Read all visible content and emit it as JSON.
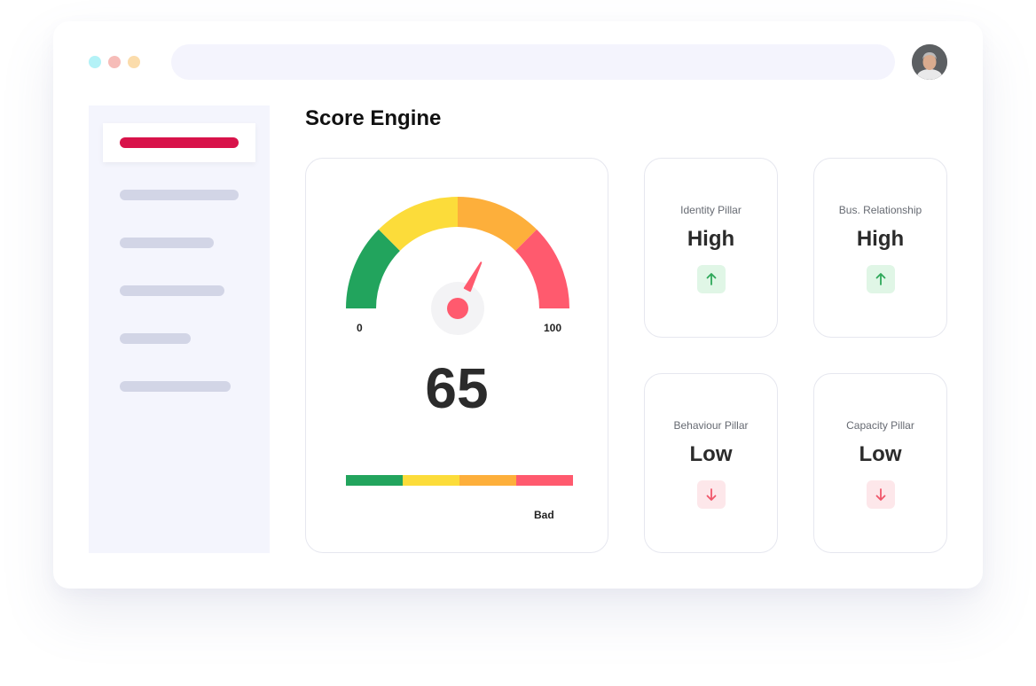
{
  "page": {
    "title": "Score Engine"
  },
  "window": {
    "dot_colors": [
      "#b3f2f7",
      "#f6bcb8",
      "#fbdcab"
    ]
  },
  "sidebar": {
    "active_color": "#d8134a",
    "item_count": 6
  },
  "gauge": {
    "min_label": "0",
    "max_label": "100",
    "min": 0,
    "max": 100,
    "value": 65,
    "score_text": "65",
    "segment_colors": [
      "#22a45d",
      "#fcdc3a",
      "#fdaf3b",
      "#ff5a6e"
    ],
    "scale_label": "Bad"
  },
  "pillars": [
    {
      "label": "Identity Pillar",
      "value": "High",
      "trend": "up"
    },
    {
      "label": "Bus. Relationship",
      "value": "High",
      "trend": "up"
    },
    {
      "label": "Behaviour Pillar",
      "value": "Low",
      "trend": "down"
    },
    {
      "label": "Capacity Pillar",
      "value": "Low",
      "trend": "down"
    }
  ],
  "icons": {
    "up": "arrow-up-icon",
    "down": "arrow-down-icon"
  },
  "colors": {
    "up_bg": "#e0f6e6",
    "up_fg": "#2fa85a",
    "down_bg": "#fde7ea",
    "down_fg": "#f0566a"
  }
}
